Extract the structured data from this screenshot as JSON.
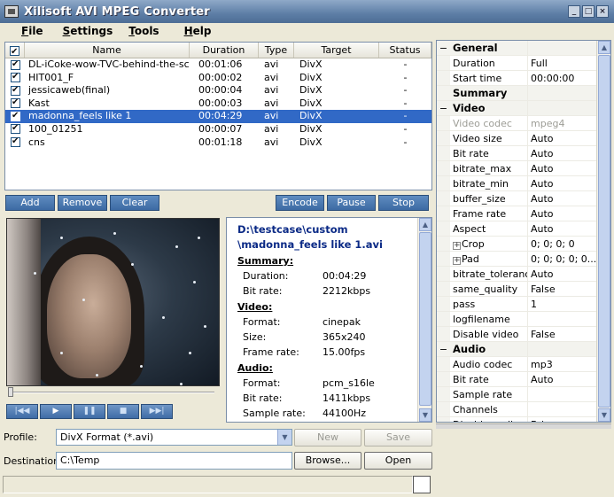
{
  "window": {
    "title": "Xilisoft AVI MPEG Converter",
    "minimize": "_",
    "maximize": "□",
    "close": "×"
  },
  "menu": [
    {
      "label": "File",
      "accel": "F",
      "rest": "ile"
    },
    {
      "label": "Settings",
      "accel": "S",
      "rest": "ettings"
    },
    {
      "label": "Tools",
      "accel": "T",
      "rest": "ools"
    },
    {
      "label": "Help",
      "accel": "H",
      "rest": "elp"
    }
  ],
  "filelist": {
    "columns": [
      "Name",
      "Duration",
      "Type",
      "Target",
      "Status"
    ],
    "rows": [
      {
        "name": "DL-iCoke-wow-TVC-behind-the-sce",
        "duration": "00:01:06",
        "type": "avi",
        "target": "DivX",
        "status": "-"
      },
      {
        "name": "HIT001_F",
        "duration": "00:00:02",
        "type": "avi",
        "target": "DivX",
        "status": "-"
      },
      {
        "name": "jessicaweb(final)",
        "duration": "00:00:04",
        "type": "avi",
        "target": "DivX",
        "status": "-"
      },
      {
        "name": "Kast",
        "duration": "00:00:03",
        "type": "avi",
        "target": "DivX",
        "status": "-"
      },
      {
        "name": "madonna_feels like 1",
        "duration": "00:04:29",
        "type": "avi",
        "target": "DivX",
        "status": "-",
        "selected": true
      },
      {
        "name": "100_01251",
        "duration": "00:00:07",
        "type": "avi",
        "target": "DivX",
        "status": "-"
      },
      {
        "name": "cns",
        "duration": "00:01:18",
        "type": "avi",
        "target": "DivX",
        "status": "-"
      }
    ]
  },
  "actions": {
    "add": "Add",
    "remove": "Remove",
    "clear": "Clear",
    "encode": "Encode",
    "pause": "Pause",
    "stop": "Stop"
  },
  "transport": {
    "prev": "|◀◀",
    "play": "▶",
    "pause": "❚❚",
    "stop": "■",
    "next": "▶▶|"
  },
  "info": {
    "path_line1": "D:\\testcase\\custom",
    "path_line2": "\\madonna_feels like 1.avi",
    "summary_head": "Summary:",
    "duration_label": "Duration:",
    "duration": "00:04:29",
    "bitrate_label": "Bit rate:",
    "bitrate": "2212kbps",
    "video_head": "Video:",
    "format_label": "Format:",
    "v_format": "cinepak",
    "size_label": "Size:",
    "v_size": "365x240",
    "framerate_label": "Frame rate:",
    "v_framerate": "15.00fps",
    "audio_head": "Audio:",
    "a_format_label": "Format:",
    "a_format": "pcm_s16le",
    "a_bitrate_label": "Bit rate:",
    "a_bitrate": "1411kbps",
    "samplerate_label": "Sample rate:",
    "a_samplerate": "44100Hz"
  },
  "profile": {
    "label": "Profile:",
    "value": "DivX Format  (*.avi)",
    "new": "New",
    "save": "Save"
  },
  "destination": {
    "label": "Destination:",
    "value": "C:\\Temp",
    "browse": "Browse...",
    "open": "Open"
  },
  "properties": [
    {
      "kind": "cat",
      "gutter": "−",
      "name": "General",
      "value": ""
    },
    {
      "name": "Duration",
      "value": "Full"
    },
    {
      "name": "Start time",
      "value": "00:00:00"
    },
    {
      "kind": "cat",
      "gutter": "",
      "name": "Summary",
      "value": ""
    },
    {
      "kind": "cat",
      "gutter": "−",
      "name": "Video",
      "value": ""
    },
    {
      "name": "Video codec",
      "value": "mpeg4",
      "disabled": true
    },
    {
      "name": "Video size",
      "value": "Auto"
    },
    {
      "name": "Bit rate",
      "value": "Auto"
    },
    {
      "name": "bitrate_max",
      "value": "Auto"
    },
    {
      "name": "bitrate_min",
      "value": "Auto"
    },
    {
      "name": "buffer_size",
      "value": "Auto"
    },
    {
      "name": "Frame rate",
      "value": "Auto"
    },
    {
      "name": "Aspect",
      "value": "Auto"
    },
    {
      "name": "Crop",
      "value": "0; 0; 0; 0",
      "expand": true
    },
    {
      "name": "Pad",
      "value": "0; 0; 0; 0; 0...",
      "expand": true
    },
    {
      "name": "bitrate_tolerance",
      "value": "Auto"
    },
    {
      "name": "same_quality",
      "value": "False"
    },
    {
      "name": "pass",
      "value": "1"
    },
    {
      "name": "logfilename",
      "value": ""
    },
    {
      "name": "Disable video",
      "value": "False"
    },
    {
      "kind": "cat",
      "gutter": "−",
      "name": "Audio",
      "value": ""
    },
    {
      "name": "Audio codec",
      "value": "mp3"
    },
    {
      "name": "Bit rate",
      "value": "Auto"
    },
    {
      "name": "Sample rate",
      "value": ""
    },
    {
      "name": "Channels",
      "value": ""
    },
    {
      "name": "Disable audio",
      "value": "False"
    }
  ],
  "colors": {
    "selection": "#3169c6",
    "accent_button": "#4a78b0",
    "path_text": "#0b2a86"
  }
}
